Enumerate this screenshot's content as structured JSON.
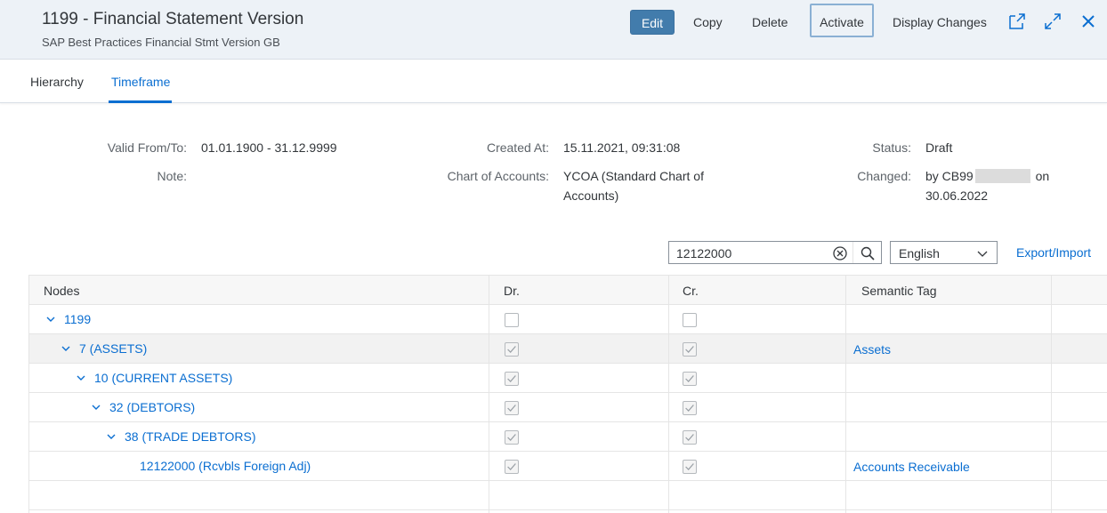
{
  "header": {
    "title": "1199 - Financial Statement Version",
    "subtitle": "SAP Best Practices Financial Stmt Version GB",
    "buttons": {
      "edit": "Edit",
      "copy": "Copy",
      "delete": "Delete",
      "activate": "Activate",
      "display_changes": "Display Changes"
    },
    "icons": [
      "share-icon",
      "fullscreen-icon",
      "close-icon"
    ]
  },
  "tabs": {
    "hierarchy": "Hierarchy",
    "timeframe": "Timeframe",
    "active": "timeframe"
  },
  "form": {
    "valid_label": "Valid From/To:",
    "valid_value": "01.01.1900 - 31.12.9999",
    "note_label": "Note:",
    "note_value": "",
    "created_label": "Created At:",
    "created_value": "15.11.2021, 09:31:08",
    "coa_label": "Chart of Accounts:",
    "coa_value_line1": "YCOA (Standard Chart of",
    "coa_value_line2": "Accounts)",
    "status_label": "Status:",
    "status_value": "Draft",
    "changed_label": "Changed:",
    "changed_by_prefix": "by CB99",
    "changed_on": "on",
    "changed_date": "30.06.2022"
  },
  "search": {
    "value": "12122000",
    "language": "English",
    "export_label": "Export/Import"
  },
  "table": {
    "headers": {
      "nodes": "Nodes",
      "dr": "Dr.",
      "cr": "Cr.",
      "semantic": "Semantic Tag"
    },
    "rows": [
      {
        "label": "1199",
        "dr": false,
        "cr": false,
        "semantic": "",
        "expanded": true
      },
      {
        "label": "7 (ASSETS)",
        "dr": true,
        "cr": true,
        "semantic": "Assets",
        "expanded": true,
        "selected": true
      },
      {
        "label": "10 (CURRENT ASSETS)",
        "dr": true,
        "cr": true,
        "semantic": "",
        "expanded": true
      },
      {
        "label": "32 (DEBTORS)",
        "dr": true,
        "cr": true,
        "semantic": "",
        "expanded": true
      },
      {
        "label": "38 (TRADE DEBTORS)",
        "dr": true,
        "cr": true,
        "semantic": "",
        "expanded": true
      },
      {
        "label": "12122000 (Rcvbls Foreign Adj)",
        "dr": true,
        "cr": true,
        "semantic": "Accounts Receivable",
        "expanded": false
      }
    ]
  },
  "colors": {
    "accent": "#0a6ed1",
    "edit_button": "#427cac",
    "header_bg": "#edf2f7"
  }
}
